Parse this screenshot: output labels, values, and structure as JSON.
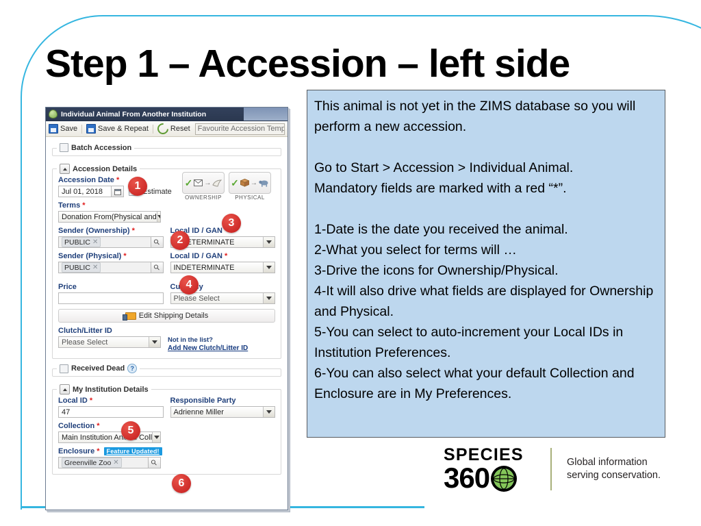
{
  "slide": {
    "title": "Step 1 – Accession – left side",
    "accent_blue": "#35b6e0",
    "panel_blue": "#bdd7ee"
  },
  "info_panel": {
    "lines": [
      "This animal is not yet in the ZIMS database so you will perform a new accession.",
      "",
      "Go to Start > Accession > Individual Animal.",
      "Mandatory fields are marked with a red “*”.",
      "",
      "1-Date is the date you received the animal.",
      "2-What you select for terms will …",
      "3-Drive the icons for Ownership/Physical.",
      "4-It will also drive what fields are displayed for Ownership and Physical.",
      "5-You can select to auto-increment your Local IDs in Institution Preferences.",
      "6-You can also select what your default Collection and Enclosure are in My Preferences."
    ]
  },
  "logo": {
    "species": "SPECIES",
    "number": "360",
    "tagline_line1": "Global information",
    "tagline_line2": "serving conservation."
  },
  "zims": {
    "titlebar": {
      "title": "Individual Animal From Another Institution",
      "icon": "leaf-icon"
    },
    "toolbar": {
      "save": "Save",
      "save_repeat": "Save & Repeat",
      "reset": "Reset",
      "template_placeholder": "Favourite Accession Templ"
    },
    "batch_accession": {
      "label": "Batch Accession",
      "checked": false
    },
    "accession_details": {
      "legend": "Accession Details",
      "accession_date_label": "Accession Date",
      "accession_date_value": "Jul 01, 2018",
      "estimate_label": "Estimate",
      "ownership_caption": "OWNERSHIP",
      "physical_caption": "PHYSICAL",
      "terms_label": "Terms",
      "terms_value": "Donation From(Physical and",
      "sender_ownership_label": "Sender (Ownership)",
      "sender_ownership_value": "PUBLIC",
      "local_id_gan_label": "Local ID / GAN",
      "local_id_gan_ownership_value": "INDETERMINATE",
      "sender_physical_label": "Sender (Physical)",
      "sender_physical_value": "PUBLIC",
      "local_id_gan_physical_value": "INDETERMINATE",
      "price_label": "Price",
      "price_value": "",
      "currency_label": "Currency",
      "currency_value": "Please Select",
      "edit_shipping_label": "Edit Shipping Details",
      "clutch_label": "Clutch/Litter ID",
      "clutch_value": "Please Select",
      "not_in_list": "Not in the list?",
      "add_new_clutch": "Add New Clutch/Litter ID"
    },
    "received_dead": {
      "label": "Received Dead",
      "checked": false,
      "help": "?"
    },
    "my_institution": {
      "legend": "My Institution Details",
      "local_id_label": "Local ID",
      "local_id_value": "47",
      "responsible_party_label": "Responsible Party",
      "responsible_party_value": "Adrienne Miller",
      "collection_label": "Collection",
      "collection_value": "Main Institution Animal Coll",
      "enclosure_label": "Enclosure",
      "enclosure_badge": "Feature Updated!",
      "enclosure_value": "Greenville Zoo"
    },
    "callouts": [
      "1",
      "2",
      "3",
      "4",
      "5",
      "6"
    ]
  }
}
